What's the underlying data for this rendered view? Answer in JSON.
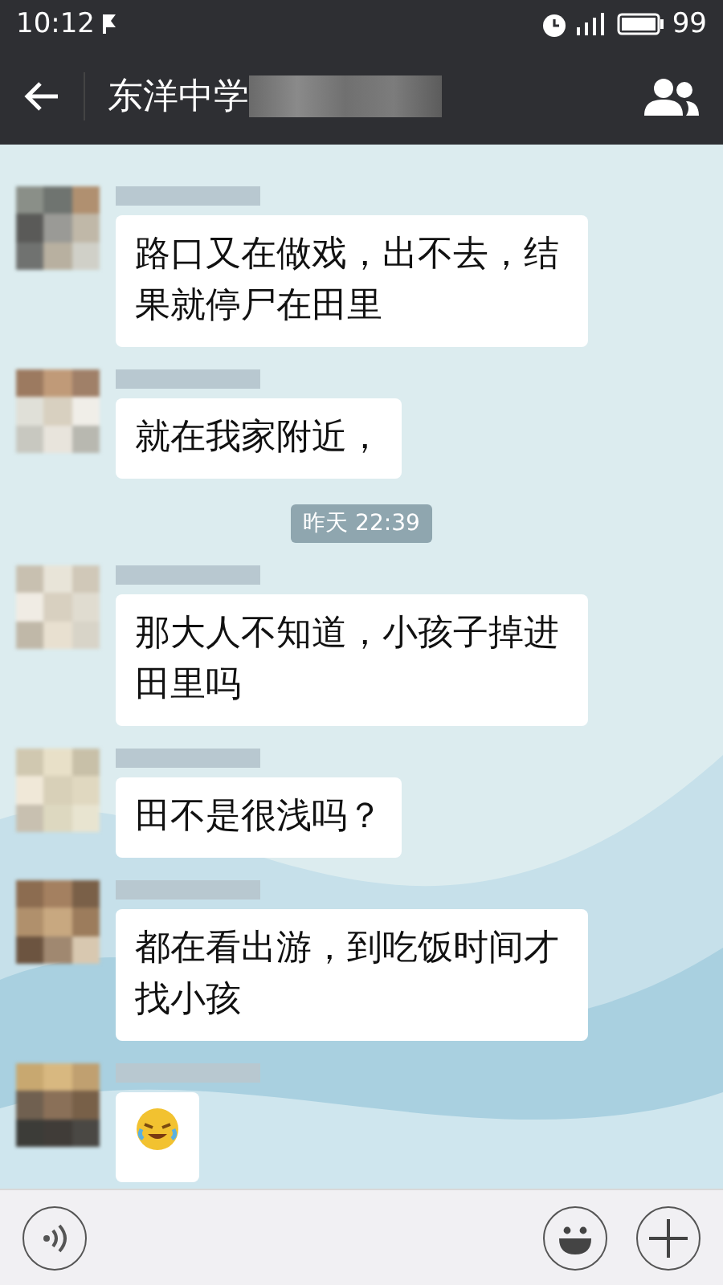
{
  "status_bar": {
    "time": "10:12",
    "battery": "99"
  },
  "header": {
    "title": "东洋中学"
  },
  "messages": [
    {
      "kind": "text",
      "text": "路口又在做戏，出不去，结果就停尸在田里"
    },
    {
      "kind": "text",
      "text": "就在我家附近，"
    },
    {
      "kind": "time",
      "text": "昨天 22:39"
    },
    {
      "kind": "text",
      "text": "那大人不知道，小孩子掉进田里吗"
    },
    {
      "kind": "text",
      "text": "田不是很浅吗？"
    },
    {
      "kind": "text",
      "text": "都在看出游，到吃饭时间才找小孩"
    },
    {
      "kind": "emoji"
    }
  ]
}
